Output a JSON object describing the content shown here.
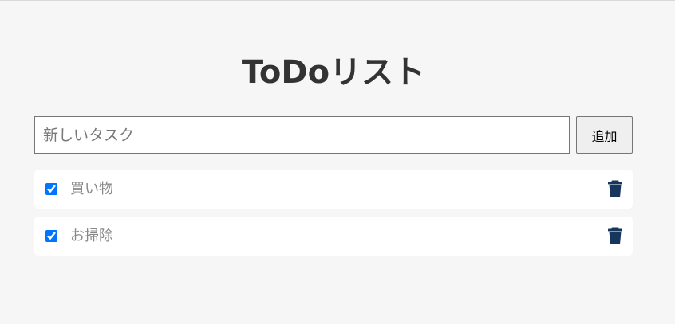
{
  "header": {
    "title": "ToDoリスト"
  },
  "new_task": {
    "placeholder": "新しいタスク",
    "value": "",
    "add_label": "追加"
  },
  "todos": [
    {
      "text": "買い物",
      "completed": true
    },
    {
      "text": "お掃除",
      "completed": true
    }
  ],
  "icons": {
    "delete": "trash-icon"
  },
  "colors": {
    "background": "#f6f6f6",
    "title": "#333333",
    "completed_text": "#888888",
    "trash_icon": "#16365b",
    "checkbox_accent": "#0075ff"
  }
}
